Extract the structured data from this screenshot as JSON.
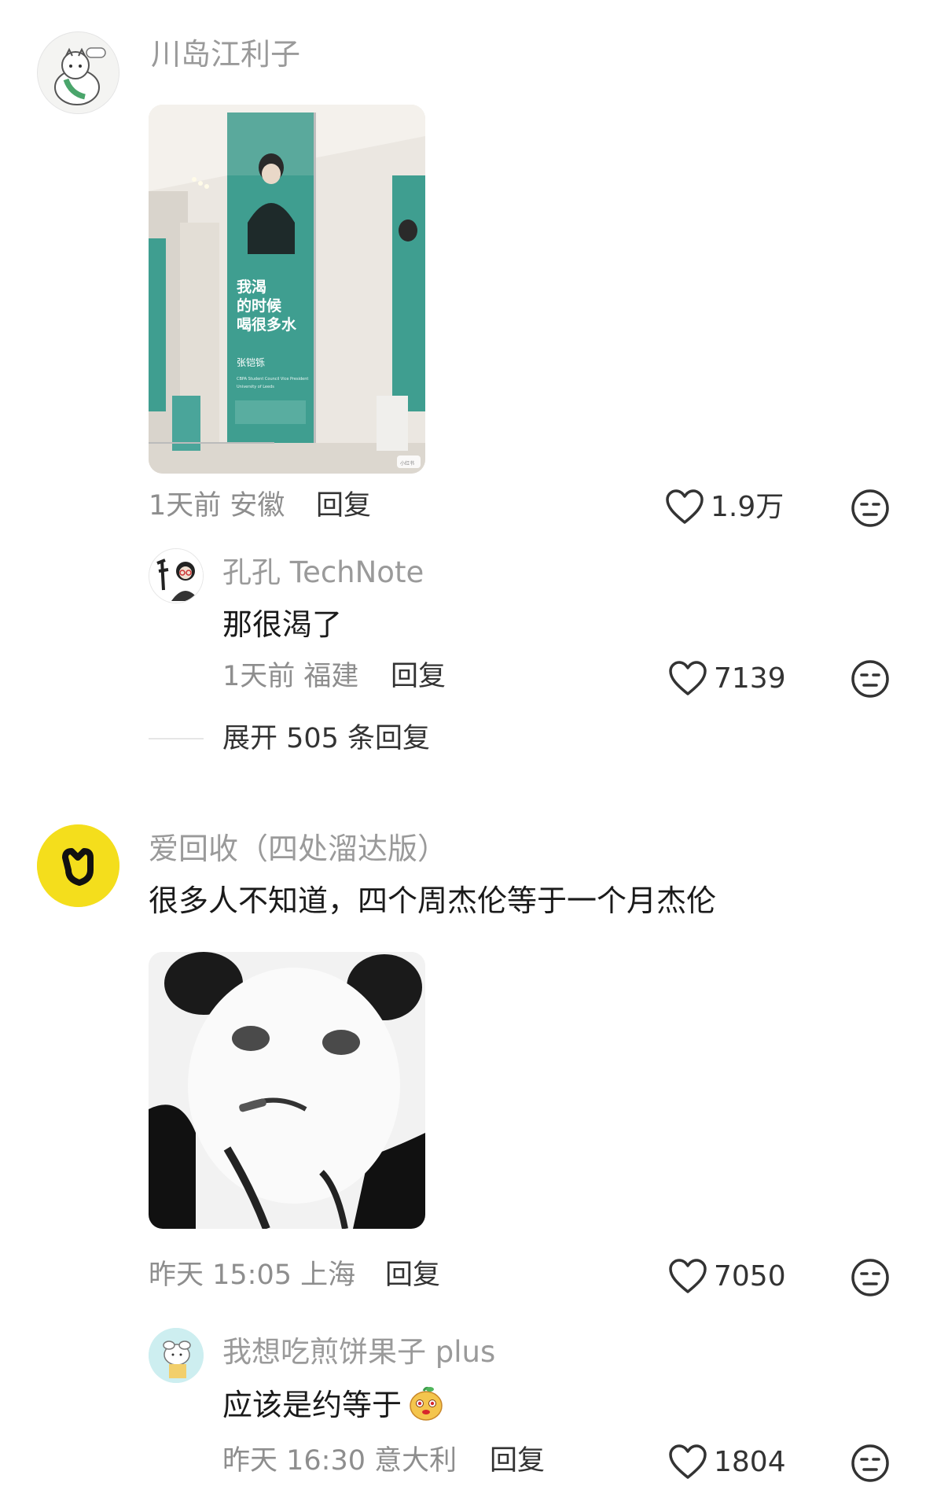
{
  "comments": [
    {
      "username": "川岛江利子",
      "time_location": "1天前 安徽",
      "reply_label": "回复",
      "likes": "1.9万",
      "banner_text": {
        "line1": "我渴",
        "line2": "的时候",
        "line3": "喝很多水",
        "name": "张铠铄",
        "role": "CBPA Student Council Vice President",
        "school": "University of Leeds",
        "watermark": "小红书"
      },
      "reply": {
        "username": "孔孔 TechNote",
        "text": "那很渴了",
        "time_location": "1天前 福建",
        "reply_label": "回复",
        "likes": "7139"
      },
      "expand_label": "展开 505 条回复"
    },
    {
      "username": "爱回收（四处溜达版）",
      "text": "很多人不知道，四个周杰伦等于一个月杰伦",
      "time_location": "昨天 15:05 上海",
      "reply_label": "回复",
      "likes": "7050",
      "reply": {
        "username": "我想吃煎饼果子 plus",
        "text": "应该是约等于",
        "time_location": "昨天 16:30 意大利",
        "reply_label": "回复",
        "likes": "1804"
      }
    }
  ],
  "icons": {
    "like": "heart-outline-icon",
    "emoji": "neutral-face-icon"
  },
  "colors": {
    "username_gray": "#9a9a9a",
    "banner_teal": "#3f9e90",
    "brand_yellow": "#f4de1c"
  }
}
